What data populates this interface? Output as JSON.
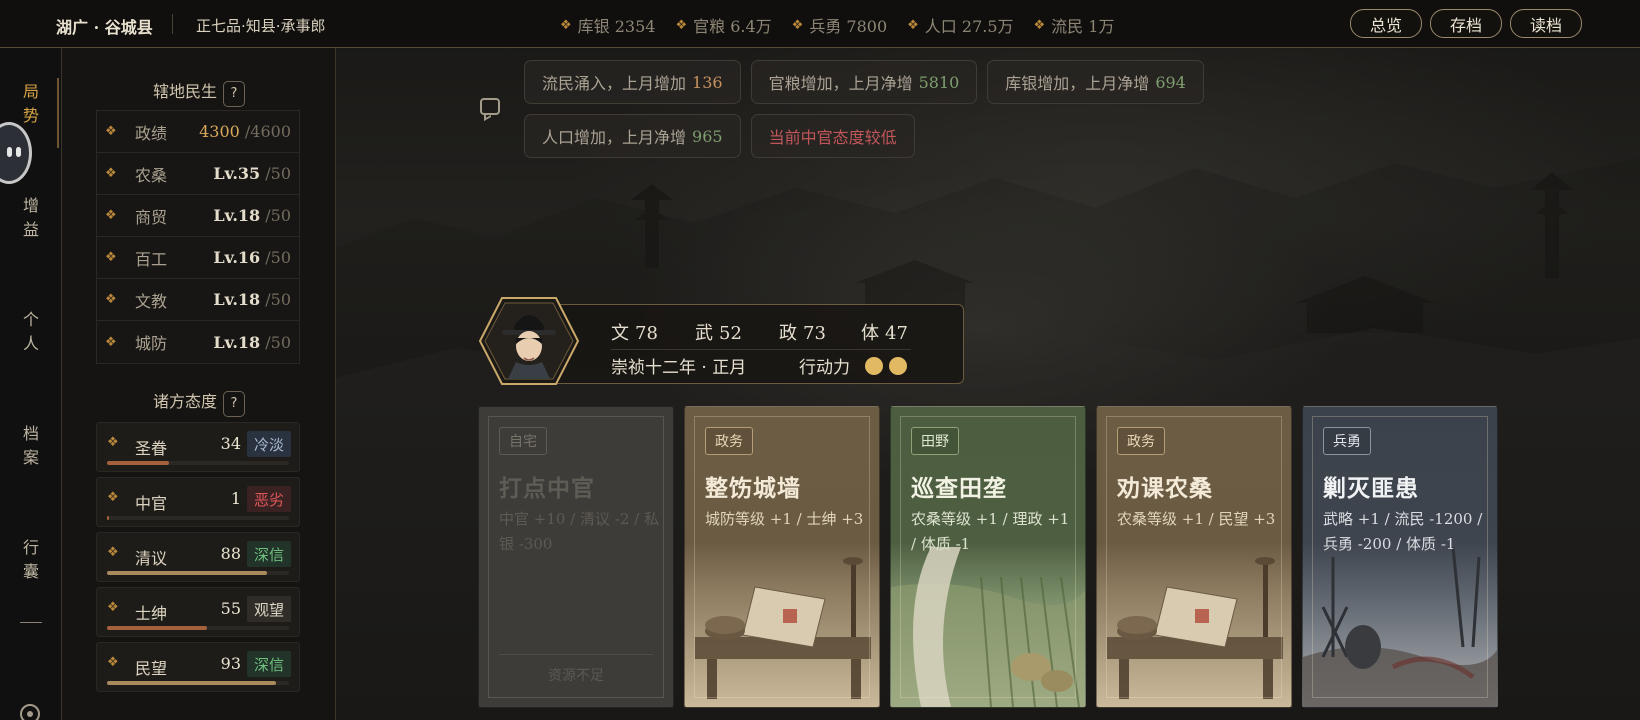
{
  "header": {
    "region": "湖广 · 谷城县",
    "rank": "正七品·知县·承事郎",
    "resources": [
      {
        "icon": "silver-icon",
        "label": "库银 2354"
      },
      {
        "icon": "grain-icon",
        "label": "官粮 6.4万"
      },
      {
        "icon": "soldier-icon",
        "label": "兵勇 7800"
      },
      {
        "icon": "population-icon",
        "label": "人口 27.5万"
      },
      {
        "icon": "refugee-icon",
        "label": "流民 1万"
      }
    ],
    "buttons": {
      "overview": "总览",
      "save": "存档",
      "load": "读档"
    }
  },
  "nav": {
    "items": [
      {
        "label": "局势",
        "active": true
      },
      {
        "label": "增益",
        "active": false
      },
      {
        "label": "个人",
        "active": false
      },
      {
        "label": "档案",
        "active": false
      },
      {
        "label": "行囊",
        "active": false
      }
    ]
  },
  "territory": {
    "title": "辖地民生",
    "help": "?",
    "stats": [
      {
        "icon": "merit-icon",
        "label": "政绩",
        "value": "4300",
        "max": "/4600"
      },
      {
        "icon": "agriculture-icon",
        "label": "农桑",
        "value": "Lv.35",
        "max": "/50"
      },
      {
        "icon": "commerce-icon",
        "label": "商贸",
        "value": "Lv.18",
        "max": "/50"
      },
      {
        "icon": "crafts-icon",
        "label": "百工",
        "value": "Lv.16",
        "max": "/50"
      },
      {
        "icon": "education-icon",
        "label": "文教",
        "value": "Lv.18",
        "max": "/50"
      },
      {
        "icon": "defense-icon",
        "label": "城防",
        "value": "Lv.18",
        "max": "/50"
      }
    ]
  },
  "attitudes": {
    "title": "诸方态度",
    "help": "?",
    "items": [
      {
        "icon": "emperor-icon",
        "label": "圣眷",
        "value": "34",
        "status": "冷淡",
        "progress": 0.34,
        "status_color": "#a9b8cf",
        "status_bg": "#2a3240",
        "bar_color": "#a5603c"
      },
      {
        "icon": "eunuch-icon",
        "label": "中官",
        "value": "1",
        "status": "恶劣",
        "progress": 0.01,
        "status_color": "#e0575a",
        "status_bg": "#3a2222",
        "bar_color": "#a5603c"
      },
      {
        "icon": "scholar-icon",
        "label": "清议",
        "value": "88",
        "status": "深信",
        "progress": 0.88,
        "status_color": "#6fbf7d",
        "status_bg": "#22332a",
        "bar_color": "#a98a5c"
      },
      {
        "icon": "gentry-icon",
        "label": "士绅",
        "value": "55",
        "status": "观望",
        "progress": 0.55,
        "status_color": "#ddd5c5",
        "status_bg": "#302d29",
        "bar_color": "#a5603c"
      },
      {
        "icon": "people-icon",
        "label": "民望",
        "value": "93",
        "status": "深信",
        "progress": 0.93,
        "status_color": "#6fbf7d",
        "status_bg": "#22332a",
        "bar_color": "#a98a5c"
      }
    ]
  },
  "news": [
    {
      "text": "流民涌入，上月增加",
      "num": "136",
      "num_color": "gold"
    },
    {
      "text": "官粮增加，上月净增",
      "num": "5810",
      "num_color": "green"
    },
    {
      "text": "库银增加，上月净增",
      "num": "694",
      "num_color": "green"
    },
    {
      "text": "人口增加，上月净增",
      "num": "965",
      "num_color": "green"
    },
    {
      "text": "当前中官态度较低",
      "num": "",
      "num_color": "warn"
    }
  ],
  "character": {
    "attrs": [
      {
        "label": "文",
        "value": "78"
      },
      {
        "label": "武",
        "value": "52"
      },
      {
        "label": "政",
        "value": "73"
      },
      {
        "label": "体",
        "value": "47"
      }
    ],
    "date": "崇祯十二年 · 正月",
    "action_label": "行动力",
    "action_points": 2
  },
  "cards": [
    {
      "tag": "自宅",
      "title": "打点中官",
      "effect": "中官 +10 / 清议 -2 / 私银 -300",
      "style": "disabled",
      "footer": "资源不足"
    },
    {
      "tag": "政务",
      "title": "整饬城墙",
      "effect": "城防等级 +1 / 士绅 +3",
      "style": "gov",
      "footer": ""
    },
    {
      "tag": "田野",
      "title": "巡查田垄",
      "effect": "农桑等级 +1 / 理政 +1 / 体质 -1",
      "style": "field",
      "footer": ""
    },
    {
      "tag": "政务",
      "title": "劝课农桑",
      "effect": "农桑等级 +1 / 民望 +3",
      "style": "gov",
      "footer": ""
    },
    {
      "tag": "兵勇",
      "title": "剿灭匪患",
      "effect": "武略 +1 / 流民 -1200 / 兵勇 -200 / 体质 -1",
      "style": "army",
      "footer": ""
    }
  ]
}
